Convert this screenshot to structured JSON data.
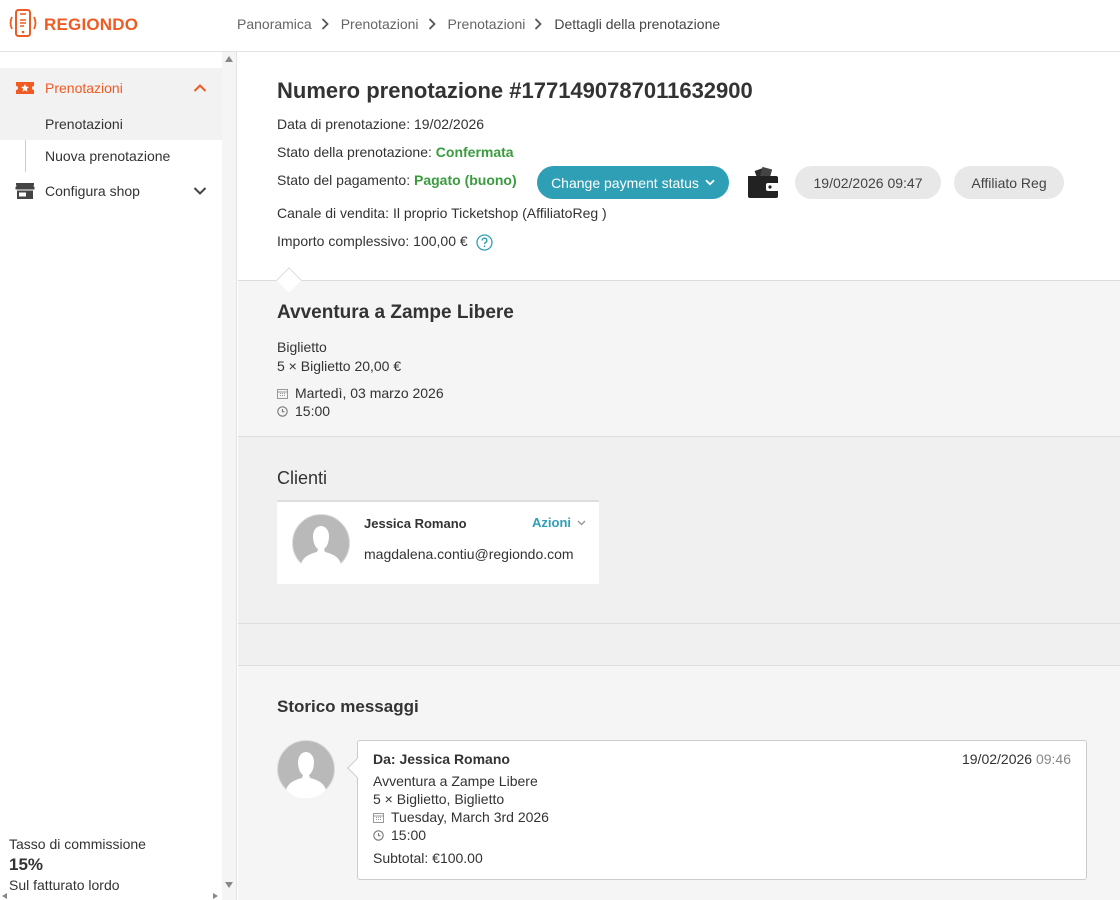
{
  "brand": {
    "name": "REGIONDO",
    "color": "#f05a23",
    "icon": "phone-logo-icon"
  },
  "breadcrumb": [
    "Panoramica",
    "Prenotazioni",
    "Prenotazioni",
    "Dettagli della prenotazione"
  ],
  "sidebar": {
    "sections": [
      {
        "label": "Prenotazioni",
        "icon": "ticket-star-icon",
        "expanded": true,
        "items": [
          {
            "label": "Prenotazioni",
            "selected": true
          },
          {
            "label": "Nuova prenotazione",
            "selected": false
          }
        ]
      },
      {
        "label": "Configura shop",
        "icon": "shop-icon",
        "expanded": false,
        "items": []
      }
    ],
    "commission": {
      "title": "Tasso di commissione",
      "value": "15%",
      "subtitle": "Sul fatturato lordo"
    }
  },
  "booking": {
    "title": "Numero prenotazione #1771490787011632900",
    "date": {
      "label": "Data di prenotazione:",
      "value": "19/02/2026"
    },
    "status": {
      "label": "Stato della prenotazione:",
      "value": "Confermata",
      "color": "#3a9b3f"
    },
    "payment": {
      "label": "Stato del pagamento:",
      "value": "Pagato (buono)",
      "color": "#3a9b3f"
    },
    "change_payment_button": "Change payment status",
    "wallet_icon": "wallet-icon",
    "timestamp_pill": "19/02/2026 09:47",
    "affiliate_pill": "Affiliato Reg",
    "channel": {
      "label": "Canale di vendita:",
      "value": "Il proprio Ticketshop (AffiliatoReg )"
    },
    "total": {
      "label": "Importo complessivo:",
      "value": "100,00 €",
      "help_icon": "question-circle-icon"
    }
  },
  "product": {
    "name": "Avventura a Zampe Libere",
    "ticket_type": "Biglietto",
    "quantity_line": "5 × Biglietto 20,00 €",
    "date": "Martedì, 03 marzo 2026",
    "time": "15:00"
  },
  "clients": {
    "title": "Clienti",
    "list": [
      {
        "name": "Jessica Romano",
        "email": "magdalena.contiu@regiondo.com",
        "actions_label": "Azioni"
      }
    ]
  },
  "messages": {
    "title": "Storico messaggi",
    "list": [
      {
        "from": "Da: Jessica Romano",
        "date": "19/02/2026",
        "time": "09:46",
        "product": "Avventura a Zampe Libere",
        "quantity": "5 × Biglietto, Biglietto",
        "event_date": "Tuesday, March 3rd 2026",
        "event_time": "15:00",
        "subtotal": "Subtotal: €100.00"
      }
    ]
  },
  "colors": {
    "accent": "#2f9fb6",
    "brand": "#f05a23",
    "success": "#3a9b3f"
  }
}
